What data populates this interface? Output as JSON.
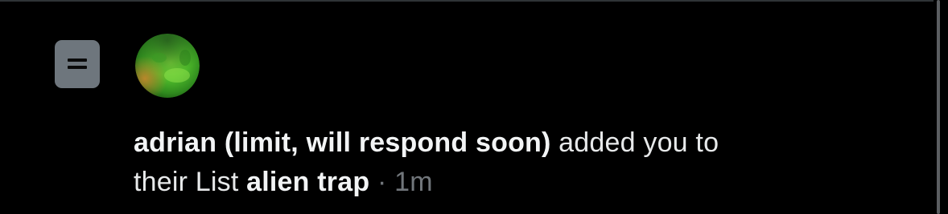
{
  "notification": {
    "icon": "list-icon",
    "avatar": "avatar",
    "user_name": "adrian (limit, will respond soon)",
    "action_text_1": " added you to",
    "action_text_2": "their List ",
    "list_name": "alien trap",
    "separator": " · ",
    "timestamp": "1m"
  },
  "colors": {
    "background": "#000000",
    "text_primary": "#e7e9ea",
    "text_muted": "#71767b",
    "icon_box": "#6e767d"
  }
}
